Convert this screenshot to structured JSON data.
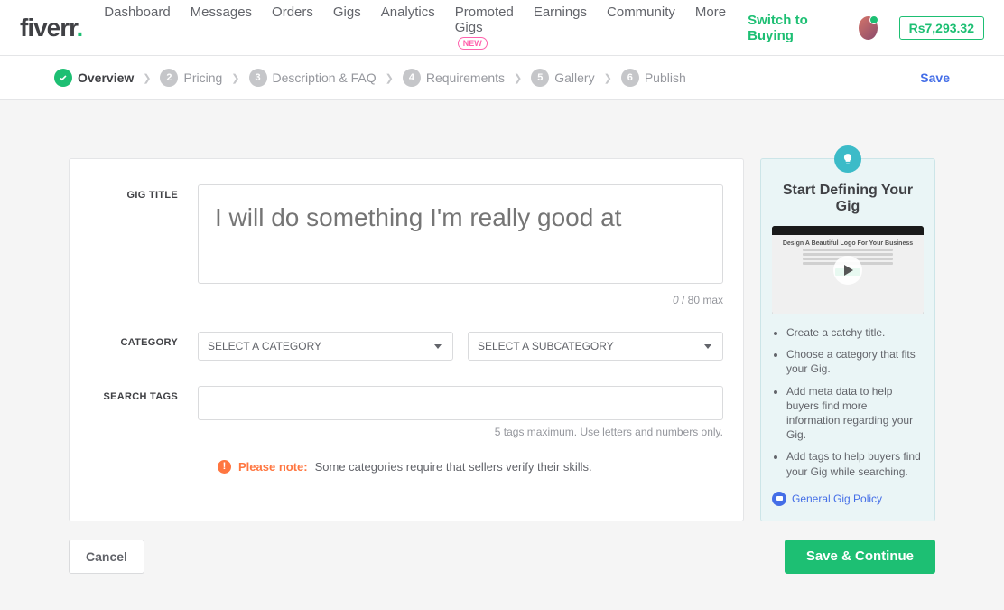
{
  "logo": {
    "text": "fiverr",
    "dot": "."
  },
  "nav": {
    "items": [
      "Dashboard",
      "Messages",
      "Orders",
      "Gigs",
      "Analytics",
      "Promoted Gigs",
      "Earnings",
      "Community",
      "More"
    ],
    "new_badge": "NEW",
    "switch": "Switch to Buying",
    "balance": "Rs7,293.32"
  },
  "steps": [
    {
      "label": "Overview",
      "active": true,
      "icon": "✓"
    },
    {
      "num": "2",
      "label": "Pricing"
    },
    {
      "num": "3",
      "label": "Description & FAQ"
    },
    {
      "num": "4",
      "label": "Requirements"
    },
    {
      "num": "5",
      "label": "Gallery"
    },
    {
      "num": "6",
      "label": "Publish"
    }
  ],
  "save_link": "Save",
  "form": {
    "title_label": "GIG TITLE",
    "title_placeholder": "I will do something I'm really good at",
    "char_count": "0",
    "char_max": " / 80 max",
    "category_label": "CATEGORY",
    "cat_placeholder": "SELECT A CATEGORY",
    "subcat_placeholder": "SELECT A SUBCATEGORY",
    "tags_label": "SEARCH TAGS",
    "tags_hint": "5 tags maximum. Use letters and numbers only.",
    "note_label": "Please note:",
    "note_text": "Some categories require that sellers verify their skills."
  },
  "side": {
    "title": "Start Defining Your Gig",
    "thumb_heading": "Design A Beautiful Logo For Your Business",
    "tips": [
      "Create a catchy title.",
      "Choose a category that fits your Gig.",
      "Add meta data to help buyers find more information regarding your Gig.",
      "Add tags to help buyers find your Gig while searching."
    ],
    "policy": "General Gig Policy"
  },
  "actions": {
    "cancel": "Cancel",
    "save": "Save & Continue"
  }
}
